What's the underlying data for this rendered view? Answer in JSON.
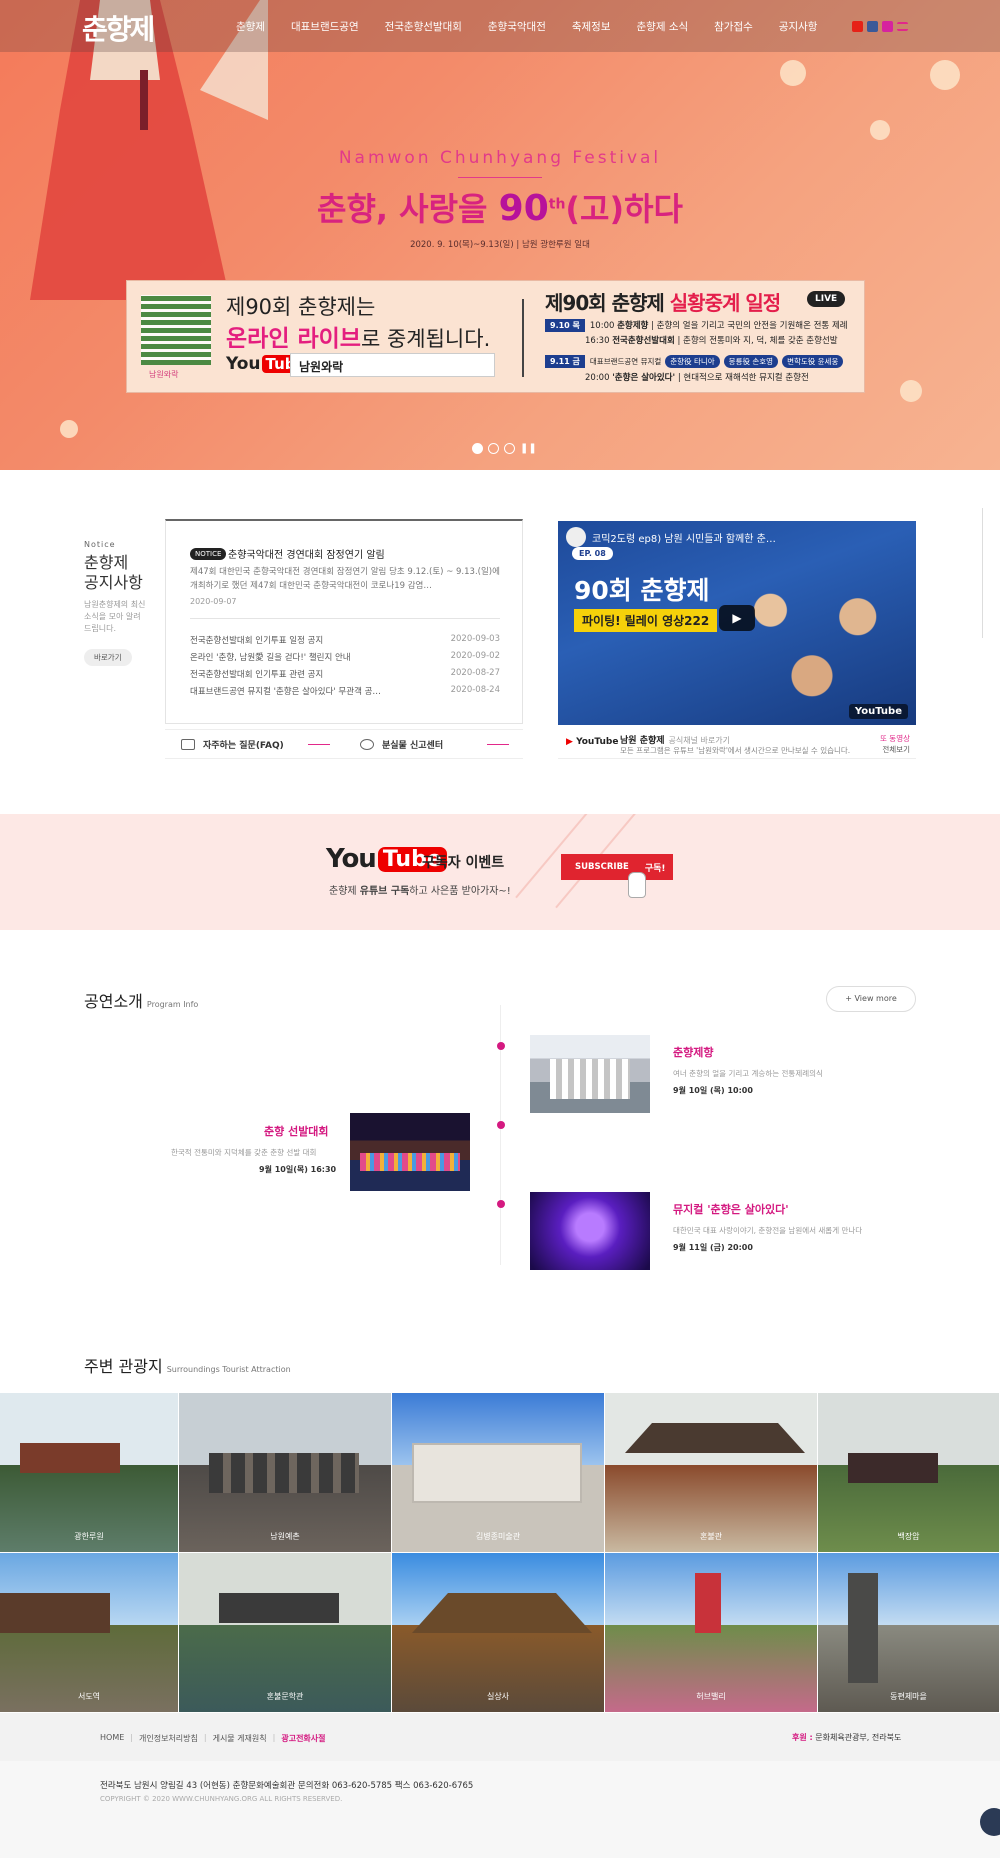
{
  "header": {
    "logo": "춘향제",
    "nav": [
      "춘향제",
      "대표브랜드공연",
      "전국춘향선발대회",
      "춘향국악대전",
      "축제정보",
      "춘향제 소식",
      "참가접수",
      "공지사항"
    ],
    "sns_icons": [
      "youtube-icon",
      "facebook-icon",
      "instagram-icon",
      "menu-icon"
    ]
  },
  "hero": {
    "subtitle": "Namwon Chunhyang Festival",
    "title_a": "춘향, 사랑을 ",
    "title_num": "90",
    "title_sup": "th",
    "title_b": "(고)하다",
    "date": "2020. 9. 10(목)~9.13(일) | 남원 광한루원 일대",
    "banner": {
      "qr_caption": "남원와락",
      "line1": "제90회 춘향제는",
      "line2_strong": "온라인 라이브",
      "line2_rest": "로 중계됩니다.",
      "yt_you": "You",
      "yt_tube": "Tube",
      "channel": "남원와락",
      "right_title_a": "제90회 춘향제 ",
      "right_title_b": "실황중계 일정",
      "live": "LIVE",
      "row1_date": "9.10 목",
      "row1_time": "10:00",
      "row1_event": "춘향제향",
      "row1_desc": "| 춘향의 얼을 기리고 국민의 안전을 기원해온 전통 제례",
      "row2_time": "16:30",
      "row2_event": "전국춘향선발대회",
      "row2_desc": "| 춘향의 전통미와 지, 덕, 체를 갖춘 춘향선발",
      "row3_date": "9.11 금",
      "row3_label": "대표브랜드공연 뮤지컬",
      "row3_chip1": "춘향役 타니아",
      "row3_chip2": "몽룡役 손호영",
      "row3_chip3": "변학도役 윤세웅",
      "row4_time": "20:00",
      "row4_event": "'춘향은 살아있다'",
      "row4_desc": "| 현대적으로 재해석한 뮤지컬 춘향전"
    }
  },
  "notice": {
    "en": "Notice",
    "title_l1": "춘향제",
    "title_l2": "공지사항",
    "desc": "남원춘향제의 최신소식을 모아 알려드립니다.",
    "btn": "바로가기",
    "badge": "NOTICE",
    "headline": "춘향국악대전 경연대회 잠정연기 알림",
    "body": "제47회 대한민국 춘향국악대전 경연대회 잠정연기 알림       당초 9.12.(토) ~ 9.13.(일)에 개최하기로 했던 제47회 대한민국 춘향국악대전이 코로나19 감염…",
    "date": "2020-09-07",
    "items": [
      {
        "t": "전국춘향선발대회 인기투표 일정 공지",
        "d": "2020-09-03"
      },
      {
        "t": "온라인 '춘향, 남원愛 길을 걷다!' 챌린지 안내",
        "d": "2020-09-02"
      },
      {
        "t": "전국춘향선발대회 인기투표 관련 공지",
        "d": "2020-08-27"
      },
      {
        "t": "대표브랜드공연 뮤지컬 '춘향은 살아있다' 무관객 공…",
        "d": "2020-08-24"
      }
    ],
    "faq": "자주하는 질문(FAQ)",
    "lost": "분실물 신고센터"
  },
  "video": {
    "title": "코믹2도령 ep8) 남원 시민들과 함께한 춘…",
    "ep": "EP. 08",
    "big": "90회 춘향제",
    "sub": "파이팅! 릴레이 영상222",
    "yt_badge": "YouTube",
    "info_yt": "YouTube",
    "channel": "남원 춘향제",
    "channel_sub": "공식채널 바로가기",
    "desc": "모든 프로그램은 유튜브 '남원와락'에서 생시간으로 만나보실 수 있습니다.",
    "r1": "또 동영상",
    "r2": "전체보기"
  },
  "subscribe": {
    "yt_you": "You",
    "yt_tube": "Tube",
    "title": "구독자 이벤트",
    "desc_a": "춘향제 ",
    "desc_b": "유튜브 구독",
    "desc_c": "하고 사은품 받아가자~!",
    "btn": "SUBSCRIBE",
    "btn_k": "구독!"
  },
  "program": {
    "title": "공연소개",
    "title_en": "Program Info",
    "more": "+ View more",
    "items": [
      {
        "t": "춘향제향",
        "d": "여너 춘향의 얼을 기리고 계승하는 전통제례의식",
        "w": "9월 10일 (목) 10:00"
      },
      {
        "t": "춘향 선발대회",
        "d": "한국적 전통미와 지덕체를 갖춘 춘향 선발 대회",
        "w": "9월 10일(목) 16:30"
      },
      {
        "t": "뮤지컬 '춘향은 살아있다'",
        "d": "대한민국 대표 사랑이야기, 춘향전을 남원에서 새롭게 만나다",
        "w": "9월 11일 (금) 20:00"
      }
    ]
  },
  "attractions": {
    "title": "주변 관광지",
    "title_en": "Surroundings Tourist Attraction",
    "items": [
      "광한루원",
      "남원예촌",
      "김병종미술관",
      "혼불관",
      "백장암",
      "서도역",
      "혼불문학관",
      "실상사",
      "허브밸리",
      "동편제마을"
    ]
  },
  "footer": {
    "links": [
      "HOME",
      "개인정보처리방침",
      "게시물 게재원칙",
      "광고전화사절"
    ],
    "sponsor_label": "후원 :",
    "sponsor": "문화체육관광부, 전라북도",
    "addr": "전라북도 남원시 양림길 43 (어현동) 춘향문화예술회관     문의전화  063-620-5785     팩스  063-620-6765",
    "copy": "COPYRIGHT © 2020 WWW.CHUNHYANG.ORG ALL RIGHTS RESERVED."
  }
}
